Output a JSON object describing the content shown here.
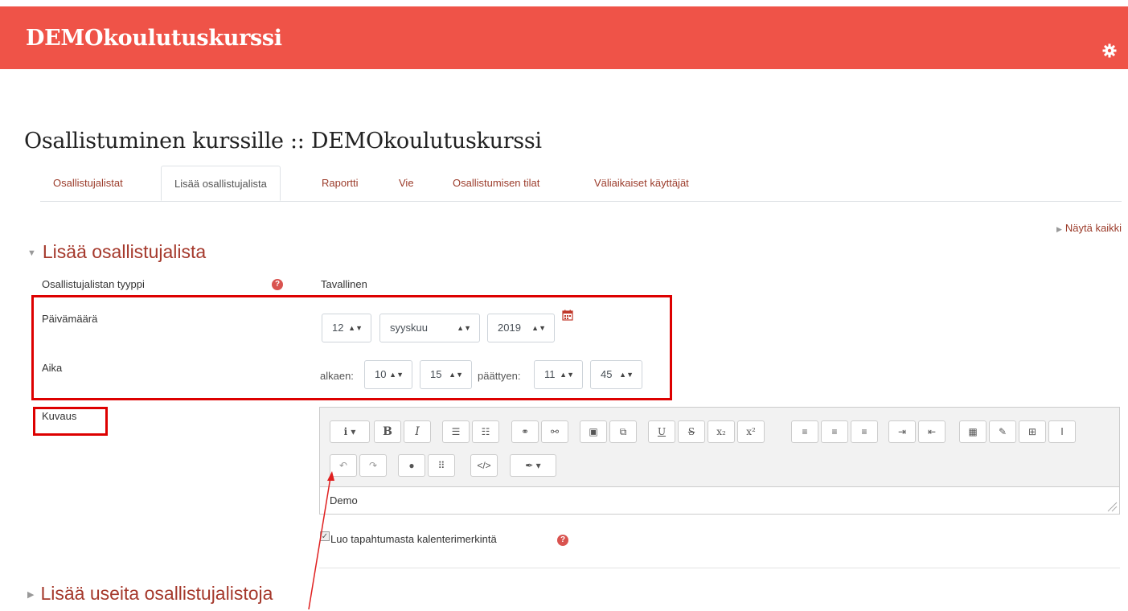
{
  "header": {
    "site_title": "DEMOkoulutuskurssi",
    "settings_icon": "gear-icon"
  },
  "page": {
    "title": "Osallistuminen kurssille :: DEMOkoulutuskurssi"
  },
  "tabs": [
    {
      "label": "Osallistujalistat"
    },
    {
      "label": "Lisää osallistujalista",
      "active": true
    },
    {
      "label": "Raportti"
    },
    {
      "label": "Vie"
    },
    {
      "label": "Osallistumisen tilat"
    },
    {
      "label": "Väliaikaiset käyttäjät"
    }
  ],
  "show_all": "Näytä kaikki",
  "section1": {
    "heading": "Lisää osallistujalista",
    "type_label": "Osallistujalistan tyyppi",
    "type_value": "Tavallinen",
    "date_label": "Päivämäärä",
    "date": {
      "day": "12",
      "month": "syyskuu",
      "year": "2019"
    },
    "time_label": "Aika",
    "from_label": "alkaen:",
    "from": {
      "hour": "10",
      "minute": "15"
    },
    "to_label": "päättyen:",
    "to": {
      "hour": "11",
      "minute": "45"
    },
    "desc_label": "Kuvaus",
    "editor_content": "Demo",
    "calendar_label": "Luo tapahtumasta kalenterimerkintä",
    "calendar_checked": true
  },
  "section2": {
    "heading": "Lisää useita osallistujalistoja"
  },
  "colors": {
    "brand": "#ef5348",
    "link": "#9b3b2a",
    "highlight": "#dd0000",
    "help": "#d9534f"
  }
}
